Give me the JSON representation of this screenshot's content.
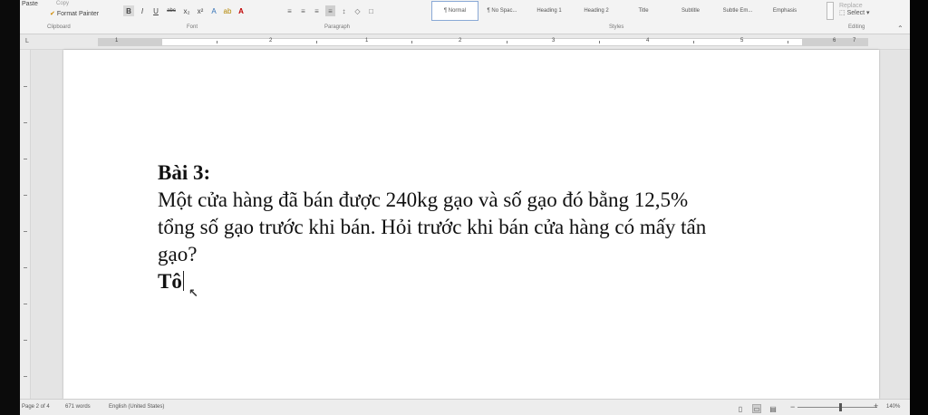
{
  "ribbon": {
    "clipboard": {
      "paste_label": "Paste",
      "copy_label": "Copy",
      "format_painter_label": "Format Painter",
      "group_label": "Clipboard"
    },
    "font": {
      "group_label": "Font",
      "buttons": [
        "B",
        "I",
        "U",
        "abc",
        "x₂",
        "x²",
        "A",
        "ab",
        "A"
      ]
    },
    "paragraph": {
      "group_label": "Paragraph"
    },
    "styles": {
      "group_label": "Styles",
      "items": [
        "¶ Normal",
        "¶ No Spac...",
        "Heading 1",
        "Heading 2",
        "Title",
        "Subtitle",
        "Subtle Em...",
        "Emphasis"
      ],
      "active_index": 0
    },
    "editing": {
      "group_label": "Editing",
      "replace_label": "Replace",
      "select_label": "Select"
    }
  },
  "ruler": {
    "numbers": [
      "1",
      "2",
      "1",
      "2",
      "3",
      "4",
      "5",
      "6",
      "7"
    ]
  },
  "document": {
    "heading": "Bài 3:",
    "lines": [
      "Một cửa hàng đã bán được 240kg gạo và số gạo đó bằng 12,5%",
      "tổng số gạo trước khi bán. Hỏi trước khi bán cửa hàng có mấy tấn",
      "gạo?"
    ],
    "typing": "Tô"
  },
  "status": {
    "page": "Page 2 of 4",
    "words": "671 words",
    "language": "English (United States)",
    "zoom": "140%"
  },
  "colors": {
    "accent": "#2b579a",
    "font_color": "#c00000",
    "highlight": "#b38600"
  }
}
